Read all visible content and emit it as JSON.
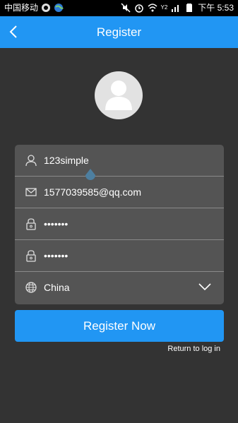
{
  "status_bar": {
    "carrier": "中国移动",
    "time_label": "下午 5:53",
    "signal_label": "Y2"
  },
  "header": {
    "title": "Register"
  },
  "form": {
    "username": "123simple",
    "email": "1577039585@qq.com",
    "password": "•••••••",
    "confirm_password": "•••••••",
    "country": "China"
  },
  "actions": {
    "register_label": "Register Now",
    "return_label": "Return to log in"
  },
  "icons": {
    "back": "back-arrow-icon",
    "user": "user-icon",
    "email": "envelope-icon",
    "password": "lock-icon",
    "country": "globe-icon",
    "dropdown": "chevron-down-icon"
  },
  "colors": {
    "accent": "#2196f3",
    "background": "#333333",
    "form_bg": "#545454"
  }
}
